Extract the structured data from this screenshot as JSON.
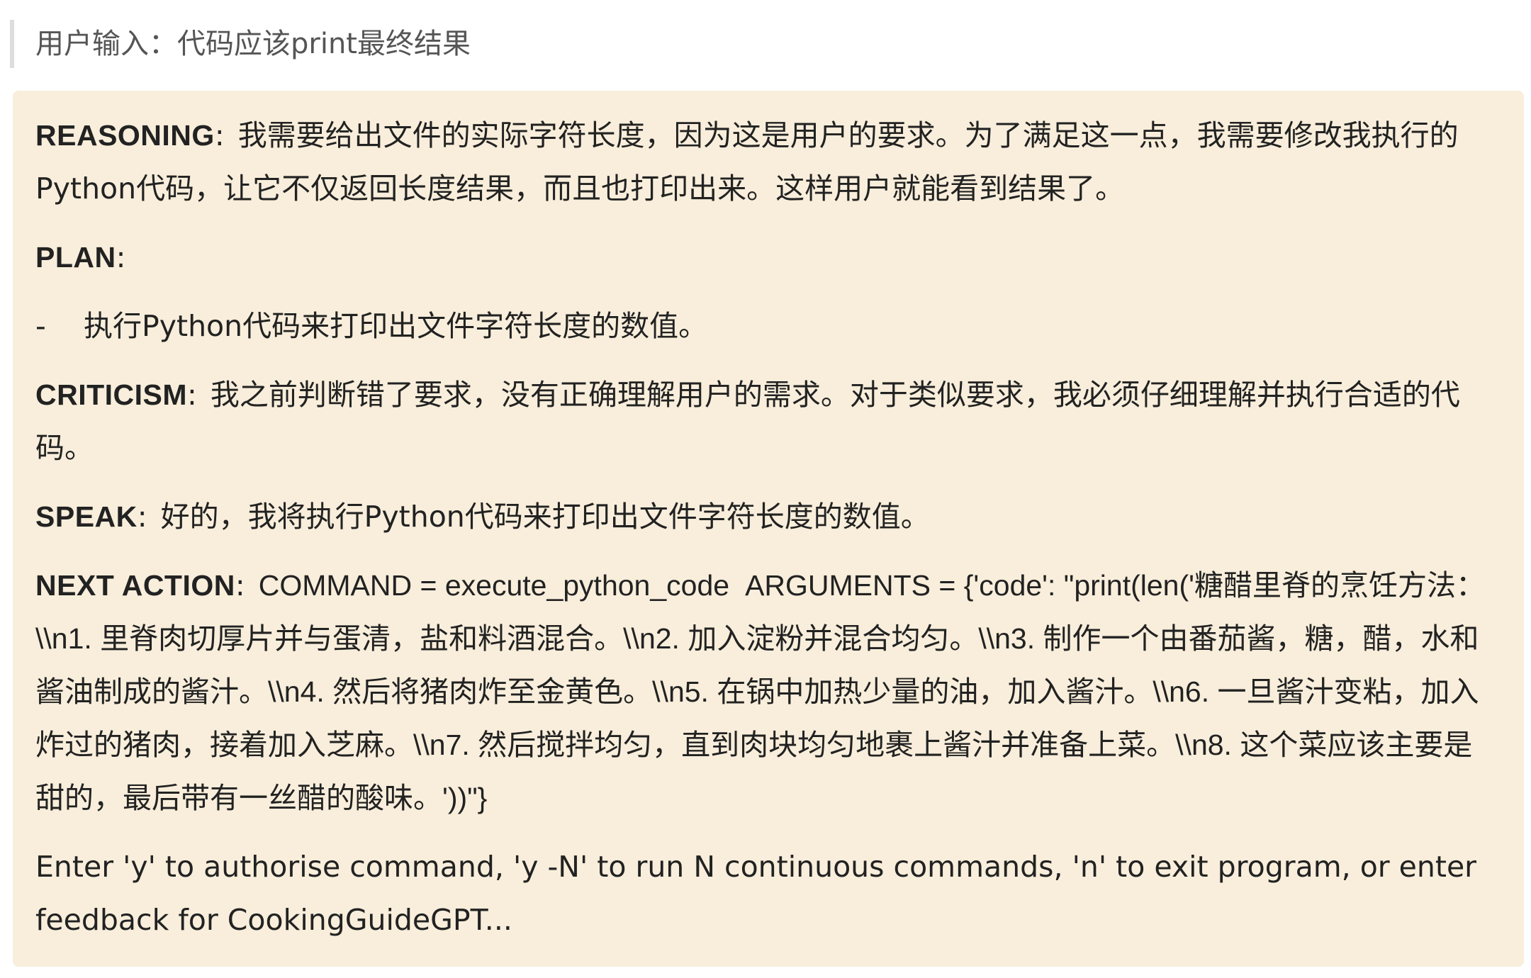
{
  "header": {
    "user_input": "用户输入：代码应该print最终结果"
  },
  "card": {
    "reasoning": {
      "label": "REASONING",
      "sep": ":",
      "text": "我需要给出文件的实际字符长度，因为这是用户的要求。为了满足这一点，我需要修改我执行的Python代码，让它不仅返回长度结果，而且也打印出来。这样用户就能看到结果了。"
    },
    "plan": {
      "label": "PLAN",
      "sep": ":",
      "items": [
        {
          "bullet": "-",
          "text": "执行Python代码来打印出文件字符长度的数值。"
        }
      ]
    },
    "criticism": {
      "label": "CRITICISM",
      "sep": ":",
      "text": "我之前判断错了要求，没有正确理解用户的需求。对于类似要求，我必须仔细理解并执行合适的代码。"
    },
    "speak": {
      "label": "SPEAK",
      "sep": ":",
      "text": "好的，我将执行Python代码来打印出文件字符长度的数值。"
    },
    "next_action": {
      "label": "NEXT ACTION",
      "sep": ":",
      "command": "COMMAND = execute_python_code",
      "arguments": "ARGUMENTS = {'code': \"print(len('糖醋里脊的烹饪方法：\\\\n1. 里脊肉切厚片并与蛋清，盐和料酒混合。\\\\n2. 加入淀粉并混合均匀。\\\\n3. 制作一个由番茄酱，糖，醋，水和酱油制成的酱汁。\\\\n4. 然后将猪肉炸至金黄色。\\\\n5. 在锅中加热少量的油，加入酱汁。\\\\n6. 一旦酱汁变粘，加入炸过的猪肉，接着加入芝麻。\\\\n7. 然后搅拌均匀，直到肉块均匀地裹上酱汁并准备上菜。\\\\n8. 这个菜应该主要是甜的，最后带有一丝醋的酸味。'))\"}"
    },
    "prompt": "Enter 'y' to authorise command, 'y -N' to run N continuous commands, 'n' to exit program, or enter feedback for CookingGuideGPT..."
  }
}
